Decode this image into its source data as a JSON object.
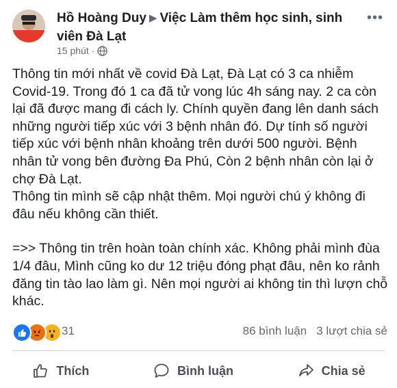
{
  "post": {
    "author": "Hồ Hoàng Duy",
    "group": "Việc Làm thêm học sinh, sinh viên Đà Lạt",
    "time": "15 phút",
    "paragraphs": [
      "Thông tin mới nhất về covid Đà  Lạt, Đà Lạt  có 3 ca nhiễm Covid-19. Trong đó 1 ca đã tử vong lúc 4h sáng nay. 2 ca còn lại đã được mang đi cách ly.  Chính quyền đang lên danh sách những người tiếp xúc với 3 bệnh nhân đó. Dự tính số người tiếp xúc với bệnh nhân khoảng trên dưới 500 người. Bệnh nhân tử vong bên đường Đa Phú, Còn 2 bệnh nhân còn lại ở chợ Đà Lạt.",
      "Thông tin mình sẽ cập nhật thêm. Mọi người chú ý không đi đâu nếu không cần thiết.",
      "=>> Thông tin trên hoàn toàn chính xác. Không phải mình đùa 1/4 đâu, Mình cũng ko dư 12 triệu đóng phạt đâu, nên ko rảnh đăng tin tào lao làm gì. Nên mọi người ai không tin thì lượn chỗ khác."
    ]
  },
  "summary": {
    "reaction_icons": [
      "like-icon",
      "angry-icon",
      "wow-icon"
    ],
    "reaction_count": "31",
    "comments": "86 bình luận",
    "shares": "3 lượt chia sẻ"
  },
  "actions": {
    "like": "Thích",
    "comment": "Bình luận",
    "share": "Chia sẻ"
  },
  "colors": {
    "like_blue": "#1877f2",
    "angry_orange": "#e9710f",
    "wow_yellow": "#f7b125",
    "secondary_text": "#65676b"
  }
}
